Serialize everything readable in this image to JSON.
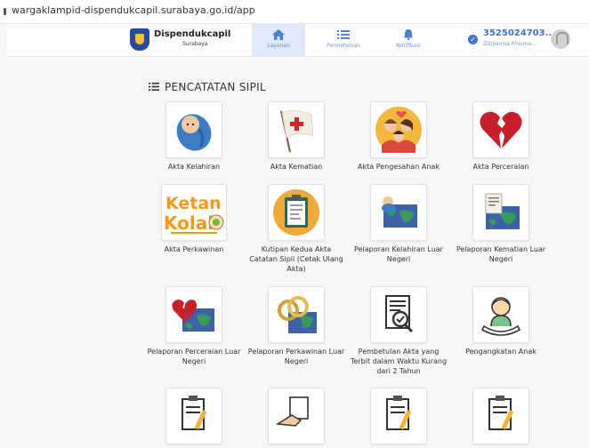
{
  "browser": {
    "url": "wargaklampid-dispendukcapil.surabaya.go.id/app"
  },
  "app": {
    "brand": "Dispendukcapil",
    "brand_sub": "Surabaya"
  },
  "nav": [
    {
      "label": "Layanan",
      "icon": "home-icon",
      "active": true
    },
    {
      "label": "Permohonan",
      "icon": "list-icon",
      "active": false
    },
    {
      "label": "Notifikasi",
      "icon": "bell-icon",
      "active": false
    }
  ],
  "user": {
    "id": "3525024703...",
    "name": "Zilzjianisa Rhisma..."
  },
  "section": {
    "title": "PENCATATAN SIPIL"
  },
  "services": [
    {
      "label": "Akta Kelahiran",
      "icon": "baby-icon"
    },
    {
      "label": "Akta Kematian",
      "icon": "red-cross-flag-icon"
    },
    {
      "label": "Akta Pengesahan Anak",
      "icon": "family-icon"
    },
    {
      "label": "Akta Perceraian",
      "icon": "broken-heart-icon"
    },
    {
      "label": "Akta Perkawinan",
      "icon": "ketan-kolak-logo"
    },
    {
      "label": "Kutipan Kedua Akta Catatan Sipil (Cetak Ulang Akta)",
      "icon": "clipboard-document-icon"
    },
    {
      "label": "Pelaporan Kelahiran Luar Negeri",
      "icon": "world-map-baby-icon"
    },
    {
      "label": "Pelaporan Kematian Luar Negeri",
      "icon": "world-map-certificate-icon"
    },
    {
      "label": "Pelaporan Perceraian Luar Negeri",
      "icon": "world-map-broken-heart-icon"
    },
    {
      "label": "Pelaporan Perkawinan Luar Negeri",
      "icon": "rings-icon"
    },
    {
      "label": "Pembetulan Akta yang Terbit dalam Waktu Kurang dari 2 Tahun",
      "icon": "document-magnifier-icon"
    },
    {
      "label": "Pengangkatan Anak",
      "icon": "child-hand-icon"
    },
    {
      "label": "",
      "icon": "clipboard-pen-icon"
    },
    {
      "label": "",
      "icon": "hand-document-icon"
    },
    {
      "label": "",
      "icon": "clipboard-pen-icon"
    },
    {
      "label": "",
      "icon": "clipboard-pen-icon"
    }
  ],
  "colors": {
    "accent": "#3f74d8",
    "nav_active_bg": "#dfe9fb",
    "heart": "#c8202a",
    "map_green": "#3a9a5a",
    "map_blue": "#3d62a8"
  }
}
